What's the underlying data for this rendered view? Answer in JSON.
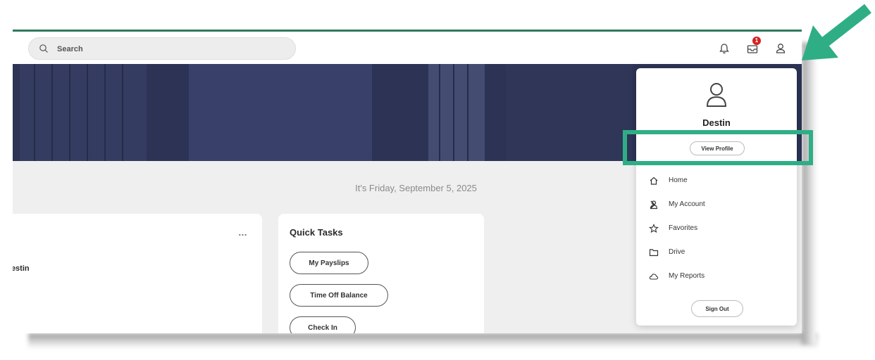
{
  "search": {
    "placeholder": "Search"
  },
  "notifications": {
    "badge_count": "1"
  },
  "date_line": "It's Friday, September 5, 2025",
  "welcome_card": {
    "greeting": "Destin",
    "more_label": "…"
  },
  "quick_tasks": {
    "title": "Quick Tasks",
    "items": [
      "My Payslips",
      "Time Off Balance",
      "Check In"
    ]
  },
  "profile_menu": {
    "name": "Destin",
    "view_profile_label": "View Profile",
    "items": [
      {
        "label": "Home",
        "icon": "home-icon"
      },
      {
        "label": "My Account",
        "icon": "user-icon",
        "has_submenu": true
      },
      {
        "label": "Favorites",
        "icon": "star-icon"
      },
      {
        "label": "Drive",
        "icon": "folder-icon"
      },
      {
        "label": "My Reports",
        "icon": "cloud-icon"
      }
    ],
    "sign_out_label": "Sign Out"
  },
  "annotation": {
    "highlight_color": "#2fae86",
    "arrow_color": "#2fae86"
  },
  "colors": {
    "accent_line": "#2f7a5c",
    "hero_overlay": "#2c3355",
    "badge": "#d32222"
  }
}
